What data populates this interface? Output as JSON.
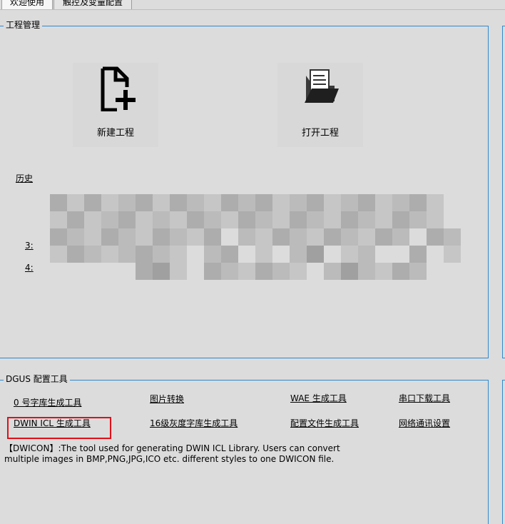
{
  "tabs": [
    {
      "label": "欢迎使用",
      "active": true
    },
    {
      "label": "触控及变量配置",
      "active": false
    }
  ],
  "project": {
    "title": "工程管理",
    "new_label": "新建工程",
    "open_label": "打开工程",
    "history_label": "历史",
    "history_items": [
      "3:",
      "4:"
    ]
  },
  "config": {
    "title": "DGUS 配置工具",
    "tools": [
      [
        "0 号字库生成工具",
        "图片转换",
        "WAE 生成工具",
        "串口下载工具"
      ],
      [
        "DWIN ICL 生成工具",
        "16级灰度字库生成工具",
        "配置文件生成工具",
        "网络通讯设置"
      ]
    ],
    "description": "【DWICON】:The tool used for generating DWIN ICL Library. Users can convert multiple images in BMP,PNG,JPG,ICO etc. different styles to one DWICON file."
  },
  "colors": {
    "accent": "#2f8ad0",
    "highlight": "#e0101a",
    "background": "#dcdcdc"
  }
}
